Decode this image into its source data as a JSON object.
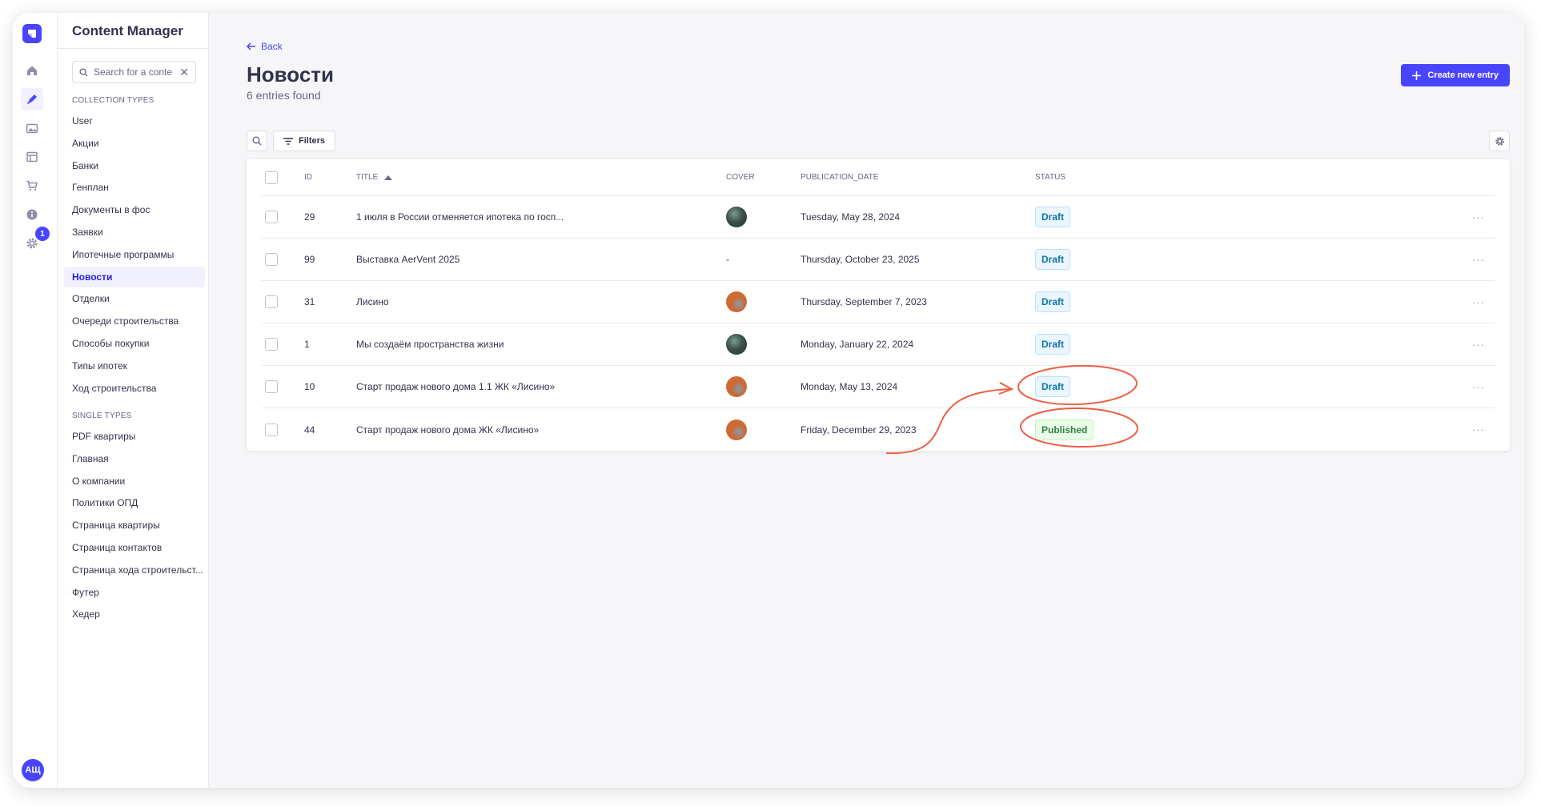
{
  "app": {
    "title": "Content Manager",
    "logo_icon": "strapi-logo-icon",
    "brand_color": "#4945ff"
  },
  "rail": {
    "items": [
      {
        "icon": "home-icon"
      },
      {
        "icon": "content-manager-icon",
        "active": true
      },
      {
        "icon": "media-library-icon"
      },
      {
        "icon": "layout-icon"
      },
      {
        "icon": "shopping-cart-icon"
      },
      {
        "icon": "info-icon"
      },
      {
        "icon": "settings-icon",
        "badge": "1"
      }
    ],
    "avatar_initials": "АЩ"
  },
  "subnav": {
    "search_placeholder": "Search for a conte",
    "collection_label": "COLLECTION TYPES",
    "collection_types": [
      "User",
      "Акции",
      "Банки",
      "Генплан",
      "Документы в фос",
      "Заявки",
      "Ипотечные программы",
      "Новости",
      "Отделки",
      "Очереди строительства",
      "Способы покупки",
      "Типы ипотек",
      "Ход строительства"
    ],
    "active_item": "Новости",
    "single_label": "SINGLE TYPES",
    "single_types": [
      "PDF квартиры",
      "Главная",
      "О компании",
      "Политики ОПД",
      "Страница квартиры",
      "Страница контактов",
      "Страница хода строительст...",
      "Футер",
      "Хедер"
    ]
  },
  "header": {
    "back_label": "Back",
    "title": "Новости",
    "subtitle": "6 entries found",
    "create_label": "Create new entry",
    "filters_label": "Filters"
  },
  "table": {
    "columns": {
      "id": "ID",
      "title": "TITLE",
      "cover": "COVER",
      "date": "PUBLICATION_DATE",
      "status": "STATUS"
    },
    "rows": [
      {
        "id": "29",
        "title": "1 июля в России отменяется ипотека по госп...",
        "cover": "dark-green",
        "date": "Tuesday, May 28, 2024",
        "status": "Draft"
      },
      {
        "id": "99",
        "title": "Выставка AerVent 2025",
        "cover": "none",
        "cover_text": "-",
        "date": "Thursday, October 23, 2025",
        "status": "Draft"
      },
      {
        "id": "31",
        "title": "Лисино",
        "cover": "orange",
        "date": "Thursday, September 7, 2023",
        "status": "Draft"
      },
      {
        "id": "1",
        "title": "Мы создаём пространства жизни",
        "cover": "dark-green",
        "date": "Monday, January 22, 2024",
        "status": "Draft"
      },
      {
        "id": "10",
        "title": "Старт продаж нового дома 1.1 ЖК «Лисино»",
        "cover": "orange",
        "date": "Monday, May 13, 2024",
        "status": "Draft"
      },
      {
        "id": "44",
        "title": "Старт продаж нового дома ЖК «Лисино»",
        "cover": "orange",
        "date": "Friday, December 29, 2023",
        "status": "Published"
      }
    ],
    "row_actions_label": "···"
  },
  "colors": {
    "draft": "#0c75af",
    "published": "#328048",
    "annotation": "#ee5e43"
  }
}
